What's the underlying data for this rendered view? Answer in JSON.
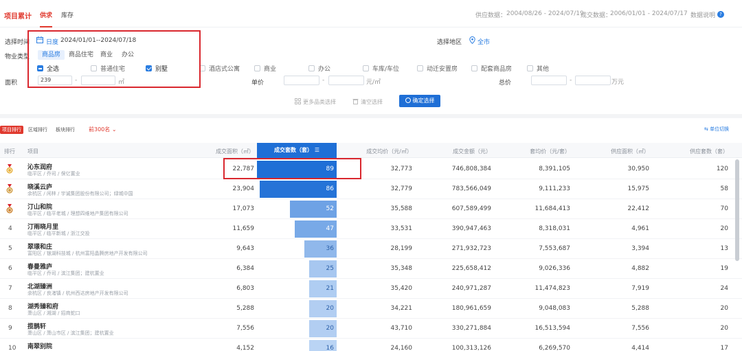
{
  "topbar": {
    "title": "项目累计",
    "tabs": [
      "供求",
      "库存"
    ],
    "supply_label": "供应数据：",
    "supply_range": "2004/08/26 - 2024/07/19",
    "deal_label": "成交数据：",
    "deal_range": "2006/01/01 - 2024/07/17",
    "help_label": "数据说明",
    "help_icon": "?"
  },
  "filters": {
    "time_label": "选择时间",
    "time_mode": "日度",
    "time_range": "2024/01/01--2024/07/18",
    "region_label": "选择地区",
    "region_value": "全市",
    "type_label": "物业类型",
    "type_tabs": [
      "商品房",
      "商品住宅",
      "商业",
      "办公"
    ],
    "checkboxes": [
      {
        "label": "全选",
        "state": "indeterminate"
      },
      {
        "label": "普通住宅",
        "state": "off"
      },
      {
        "label": "别墅",
        "state": "on"
      },
      {
        "label": "酒店式公寓",
        "state": "off"
      },
      {
        "label": "商业",
        "state": "off"
      },
      {
        "label": "办公",
        "state": "off"
      },
      {
        "label": "车库/车位",
        "state": "off"
      },
      {
        "label": "动迁安置房",
        "state": "off"
      },
      {
        "label": "配套商品房",
        "state": "off"
      },
      {
        "label": "其他",
        "state": "off"
      }
    ],
    "area_label": "面积",
    "area_min": "239",
    "area_unit": "㎡",
    "price_label": "单价",
    "price_unit": "元/㎡",
    "total_label": "总价",
    "total_unit": "万元",
    "dash": "-",
    "more_btn": "更多品类选择",
    "clear_btn": "清空选择",
    "confirm_btn": "确定选择"
  },
  "ranking": {
    "tabs": [
      "项目排行",
      "区域排行",
      "板块排行"
    ],
    "top_n": "前300名",
    "unit_switch": "单位切换"
  },
  "table": {
    "headers": {
      "rank": "排行",
      "project": "项目",
      "area": "成交面积（㎡）",
      "units": "成交套数（套）",
      "avg_price": "成交均价（元/㎡）",
      "amount": "成交金额（元）",
      "avg_total": "套均价（元/套）",
      "supply_area": "供应面积（㎡）",
      "supply_units": "供应套数（套）"
    },
    "max_units": 89,
    "rows": [
      {
        "rank": "1",
        "name": "沁东润府",
        "sub": "临平区 / 乔司 / 保亿置业",
        "area": "22,787",
        "units": 89,
        "avg_price": "32,773",
        "amount": "746,808,384",
        "avg_total": "8,391,105",
        "supply_area": "30,950",
        "supply_units": "120",
        "medal": "gold"
      },
      {
        "rank": "2",
        "name": "晓溪云庐",
        "sub": "余杭区 / 闲林 / 宇诚集团股份有限公司；绿城中国",
        "area": "23,904",
        "units": 86,
        "avg_price": "32,779",
        "amount": "783,566,049",
        "avg_total": "9,111,233",
        "supply_area": "15,975",
        "supply_units": "58",
        "medal": "silver"
      },
      {
        "rank": "3",
        "name": "汀山和院",
        "sub": "临平区 / 临平老城 / 理想四维地产集团有限公司",
        "area": "17,073",
        "units": 52,
        "avg_price": "35,588",
        "amount": "607,589,499",
        "avg_total": "11,684,413",
        "supply_area": "22,412",
        "supply_units": "70",
        "medal": "bronze"
      },
      {
        "rank": "4",
        "name": "汀雨晓月里",
        "sub": "临平区 / 临平新城 / 浙江交投",
        "area": "11,659",
        "units": 47,
        "avg_price": "33,531",
        "amount": "390,947,463",
        "avg_total": "8,318,031",
        "supply_area": "4,961",
        "supply_units": "20",
        "medal": ""
      },
      {
        "rank": "5",
        "name": "翠璟和庄",
        "sub": "富阳区 / 银湖科技城 / 杭州富阳晶腾房地产开发有限公司",
        "area": "9,643",
        "units": 36,
        "avg_price": "28,199",
        "amount": "271,932,723",
        "avg_total": "7,553,687",
        "supply_area": "3,394",
        "supply_units": "13",
        "medal": ""
      },
      {
        "rank": "6",
        "name": "春曼雅庐",
        "sub": "临平区 / 乔司 / 滨江集团；建杭置业",
        "area": "6,384",
        "units": 25,
        "avg_price": "35,348",
        "amount": "225,658,412",
        "avg_total": "9,026,336",
        "supply_area": "4,882",
        "supply_units": "19",
        "medal": ""
      },
      {
        "rank": "7",
        "name": "北湖臻洲",
        "sub": "余杭区 / 良渚镇 / 杭州西达房地产开发有限公司",
        "area": "6,803",
        "units": 21,
        "avg_price": "35,420",
        "amount": "240,971,287",
        "avg_total": "11,474,823",
        "supply_area": "7,919",
        "supply_units": "24",
        "medal": ""
      },
      {
        "rank": "8",
        "name": "湖秀臻和府",
        "sub": "萧山区 / 湘湖 / 招商蛇口",
        "area": "5,288",
        "units": 20,
        "avg_price": "34,221",
        "amount": "180,961,659",
        "avg_total": "9,048,083",
        "supply_area": "5,288",
        "supply_units": "20",
        "medal": ""
      },
      {
        "rank": "9",
        "name": "揽鹊轩",
        "sub": "萧山区 / 萧山市区 / 滨江集团；建杭置业",
        "area": "7,556",
        "units": 20,
        "avg_price": "43,710",
        "amount": "330,271,884",
        "avg_total": "16,513,594",
        "supply_area": "7,556",
        "supply_units": "20",
        "medal": ""
      },
      {
        "rank": "10",
        "name": "南翠别院",
        "sub": "",
        "area": "4,152",
        "units": 16,
        "avg_price": "24,160",
        "amount": "100,313,126",
        "avg_total": "6,269,570",
        "supply_area": "4,414",
        "supply_units": "17",
        "medal": ""
      }
    ]
  },
  "colors": {
    "accent_red": "#e0392e",
    "primary_blue": "#1f6fd6",
    "highlight_box": "#d9272e"
  }
}
